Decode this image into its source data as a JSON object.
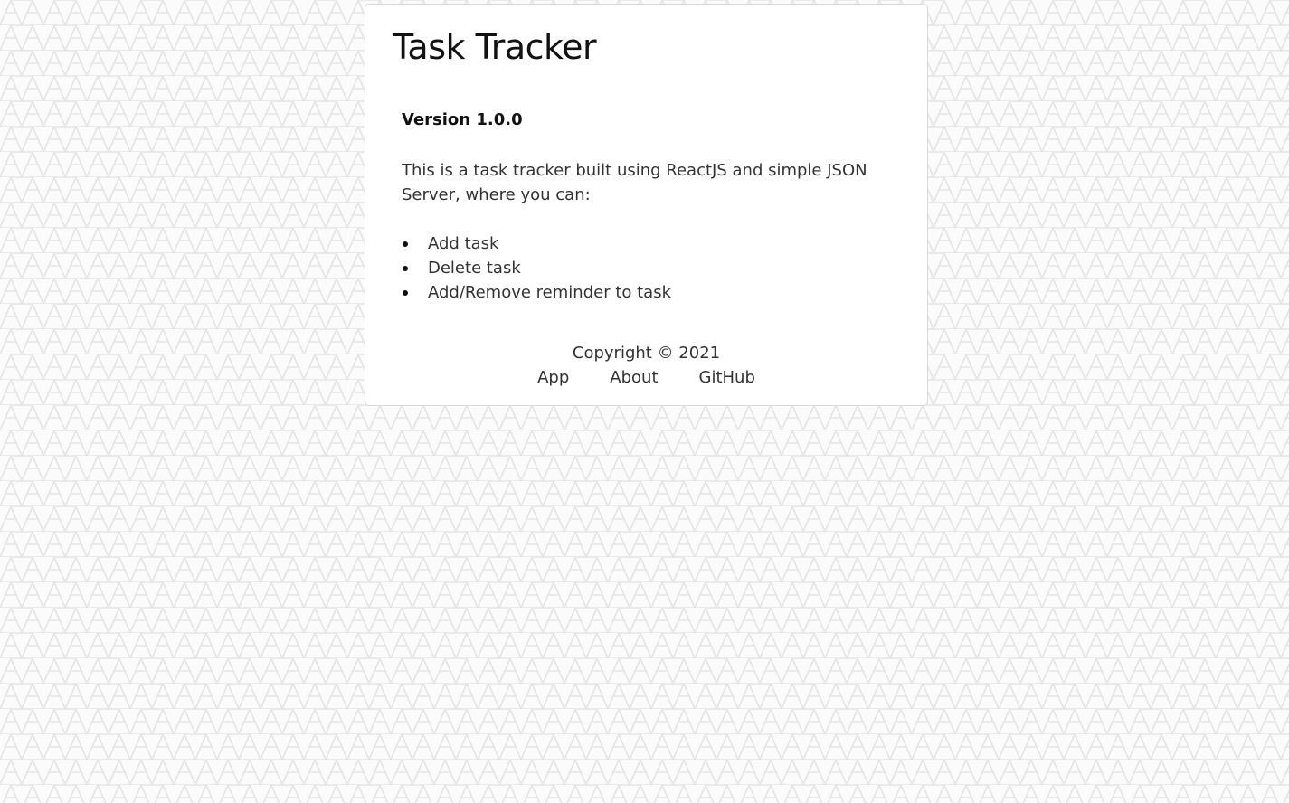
{
  "app": {
    "title": "Task Tracker"
  },
  "about": {
    "version": "Version 1.0.0",
    "description": "This is a task tracker built using ReactJS and simple JSON Server, where you can:",
    "features": [
      "Add task",
      "Delete task",
      "Add/Remove reminder to task"
    ]
  },
  "footer": {
    "copyright": "Copyright © 2021",
    "links": [
      {
        "label": "App"
      },
      {
        "label": "About"
      },
      {
        "label": "GitHub"
      }
    ]
  },
  "colors": {
    "background": "#fbfbfb",
    "pattern_stroke": "#e4e4e4",
    "card_background": "#ffffff",
    "card_border": "#d9d9d9",
    "text": "#333333",
    "heading": "#111111"
  }
}
